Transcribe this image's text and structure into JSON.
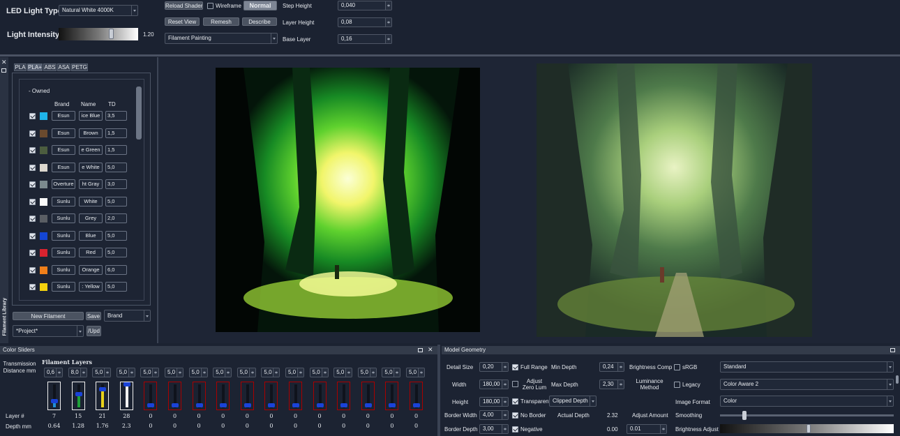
{
  "top": {
    "led_label": "LED Light Type",
    "led_value": "Natural White 4000K",
    "intensity_label": "Light Intensity",
    "intensity_value": "1.20",
    "intensity_fraction": 0.66,
    "reload_shaders": "Reload Shaders",
    "wireframe": "Wireframe",
    "normal": "Normal",
    "reset_view": "Reset View",
    "remesh": "Remesh",
    "describe": "Describe",
    "mode_select": "Filament Painting",
    "step_height_label": "Step Height",
    "step_height": "0,040",
    "layer_height_label": "Layer Height",
    "layer_height": "0,08",
    "base_layer_label": "Base Layer",
    "base_layer": "0,16"
  },
  "library": {
    "side_title": "Filament Library",
    "tabs": [
      "PLA",
      "PLA+",
      "ABS",
      "ASA",
      "PETG"
    ],
    "group": "- Owned",
    "col_brand": "Brand",
    "col_name": "Name",
    "col_td": "TD",
    "rows": [
      {
        "color": "#1fb4ea",
        "brand": "Esun",
        "name": "ice Blue",
        "td": "3,5"
      },
      {
        "color": "#6a4a2e",
        "brand": "Esun",
        "name": "Brown",
        "td": "1,5"
      },
      {
        "color": "#4c5d3f",
        "brand": "Esun",
        "name": "e Green",
        "td": "1,5"
      },
      {
        "color": "#dcd8cf",
        "brand": "Esun",
        "name": "e White",
        "td": "5,0"
      },
      {
        "color": "#7b8a8e",
        "brand": "Overture",
        "name": "ht Gray",
        "td": "3,0"
      },
      {
        "color": "#fafafa",
        "brand": "Sunlu",
        "name": "White",
        "td": "5,0"
      },
      {
        "color": "#5a5e64",
        "brand": "Sunlu",
        "name": "Grey",
        "td": "2,0"
      },
      {
        "color": "#1446d4",
        "brand": "Sunlu",
        "name": "Blue",
        "td": "5,0"
      },
      {
        "color": "#d9232f",
        "brand": "Sunlu",
        "name": "Red",
        "td": "5,0"
      },
      {
        "color": "#f07f1a",
        "brand": "Sunlu",
        "name": "Orange",
        "td": "6,0"
      },
      {
        "color": "#f4d20f",
        "brand": "Sunlu",
        "name": ": Yellow",
        "td": "5,0"
      }
    ],
    "new_filament": "New Filament",
    "save": "Save",
    "brand_select": "Brand",
    "project_select": "*Project*",
    "update": "/Upd"
  },
  "color_sliders": {
    "title": "Color Sliders",
    "transmission_label": "Transmission Distance mm",
    "layers_title": "Filament Layers",
    "layer_label": "Layer #",
    "depth_label": "Depth mm",
    "columns": [
      {
        "td": "0,6",
        "layer": "7",
        "depth": "0.64",
        "fill": "#1f8fd6",
        "level": 0.26,
        "active": true
      },
      {
        "td": "8,0",
        "layer": "15",
        "depth": "1.28",
        "fill": "#1fa03a",
        "level": 0.55,
        "active": true
      },
      {
        "td": "5,0",
        "layer": "21",
        "depth": "1.76",
        "fill": "#e8d11a",
        "level": 0.75,
        "active": true
      },
      {
        "td": "5,0",
        "layer": "28",
        "depth": "2.3",
        "fill": "#f0f0f0",
        "level": 0.96,
        "active": true
      },
      {
        "td": "5,0",
        "layer": "0",
        "depth": "0",
        "fill": "",
        "level": 0,
        "active": false
      },
      {
        "td": "5,0",
        "layer": "0",
        "depth": "0",
        "fill": "",
        "level": 0,
        "active": false
      },
      {
        "td": "5,0",
        "layer": "0",
        "depth": "0",
        "fill": "",
        "level": 0,
        "active": false
      },
      {
        "td": "5,0",
        "layer": "0",
        "depth": "0",
        "fill": "",
        "level": 0,
        "active": false
      },
      {
        "td": "5,0",
        "layer": "0",
        "depth": "0",
        "fill": "",
        "level": 0,
        "active": false
      },
      {
        "td": "5,0",
        "layer": "0",
        "depth": "0",
        "fill": "",
        "level": 0,
        "active": false
      },
      {
        "td": "5,0",
        "layer": "0",
        "depth": "0",
        "fill": "",
        "level": 0,
        "active": false
      },
      {
        "td": "5,0",
        "layer": "0",
        "depth": "0",
        "fill": "",
        "level": 0,
        "active": false
      },
      {
        "td": "5,0",
        "layer": "0",
        "depth": "0",
        "fill": "",
        "level": 0,
        "active": false
      },
      {
        "td": "5,0",
        "layer": "0",
        "depth": "0",
        "fill": "",
        "level": 0,
        "active": false
      },
      {
        "td": "5,0",
        "layer": "0",
        "depth": "0",
        "fill": "",
        "level": 0,
        "active": false
      },
      {
        "td": "5,0",
        "layer": "0",
        "depth": "0",
        "fill": "",
        "level": 0,
        "active": false
      }
    ]
  },
  "model_geometry": {
    "title": "Model Geometry",
    "detail_size_label": "Detail Size",
    "detail_size": "0,20",
    "width_label": "Width",
    "width": "180,00",
    "height_label": "Height",
    "height": "180,00",
    "border_width_label": "Border Width",
    "border_width": "4,00",
    "border_depth_label": "Border Depth",
    "border_depth": "3,00",
    "full_range": "Full Range",
    "adjust_zero_lum": "Adjust Zero Lum",
    "transparent": "Transparent",
    "no_border": "No Border",
    "negative": "Negative",
    "min_depth_label": "Min Depth",
    "min_depth": "0,24",
    "max_depth_label": "Max Depth",
    "max_depth": "2,30",
    "clip_select": "Clipped Depth",
    "actual_depth_label": "Actual Depth",
    "actual_depth": "2.32",
    "adjust_amount_label": "Adjust Amount",
    "adjust_amount_a": "0.00",
    "adjust_amount_b": "0.01",
    "brightness_comp_label": "Brightness Comp",
    "luminance_method_label": "Luminance Method",
    "image_format_label": "Image Format",
    "smoothing_label": "Smoothing",
    "brightness_adjust_label": "Brightness Adjust",
    "srgb": "sRGB",
    "legacy": "Legacy",
    "brightness_select": "Standard",
    "luminance_select": "Color Aware 2",
    "format_select": "Color",
    "smoothing_fraction": 0.14,
    "brightness_adjust_fraction": 0.51
  }
}
